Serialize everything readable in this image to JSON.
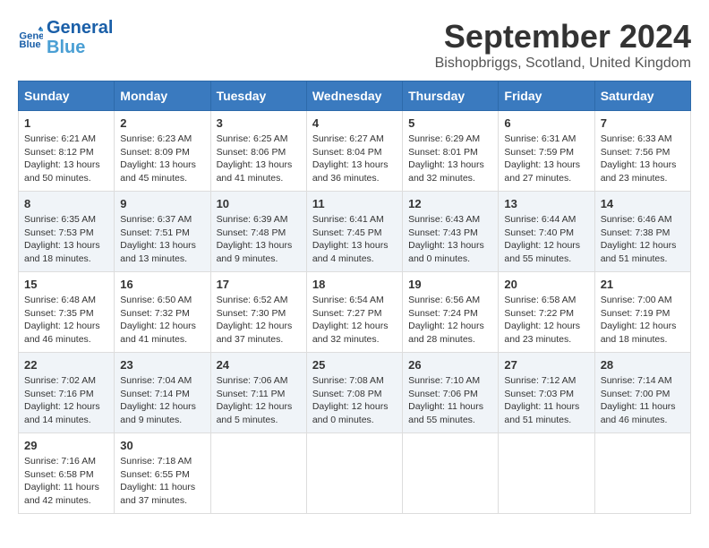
{
  "header": {
    "logo_line1": "General",
    "logo_line2": "Blue",
    "month": "September 2024",
    "location": "Bishopbriggs, Scotland, United Kingdom"
  },
  "weekdays": [
    "Sunday",
    "Monday",
    "Tuesday",
    "Wednesday",
    "Thursday",
    "Friday",
    "Saturday"
  ],
  "weeks": [
    [
      {
        "day": "1",
        "sunrise": "6:21 AM",
        "sunset": "8:12 PM",
        "daylight": "13 hours and 50 minutes."
      },
      {
        "day": "2",
        "sunrise": "6:23 AM",
        "sunset": "8:09 PM",
        "daylight": "13 hours and 45 minutes."
      },
      {
        "day": "3",
        "sunrise": "6:25 AM",
        "sunset": "8:06 PM",
        "daylight": "13 hours and 41 minutes."
      },
      {
        "day": "4",
        "sunrise": "6:27 AM",
        "sunset": "8:04 PM",
        "daylight": "13 hours and 36 minutes."
      },
      {
        "day": "5",
        "sunrise": "6:29 AM",
        "sunset": "8:01 PM",
        "daylight": "13 hours and 32 minutes."
      },
      {
        "day": "6",
        "sunrise": "6:31 AM",
        "sunset": "7:59 PM",
        "daylight": "13 hours and 27 minutes."
      },
      {
        "day": "7",
        "sunrise": "6:33 AM",
        "sunset": "7:56 PM",
        "daylight": "13 hours and 23 minutes."
      }
    ],
    [
      {
        "day": "8",
        "sunrise": "6:35 AM",
        "sunset": "7:53 PM",
        "daylight": "13 hours and 18 minutes."
      },
      {
        "day": "9",
        "sunrise": "6:37 AM",
        "sunset": "7:51 PM",
        "daylight": "13 hours and 13 minutes."
      },
      {
        "day": "10",
        "sunrise": "6:39 AM",
        "sunset": "7:48 PM",
        "daylight": "13 hours and 9 minutes."
      },
      {
        "day": "11",
        "sunrise": "6:41 AM",
        "sunset": "7:45 PM",
        "daylight": "13 hours and 4 minutes."
      },
      {
        "day": "12",
        "sunrise": "6:43 AM",
        "sunset": "7:43 PM",
        "daylight": "13 hours and 0 minutes."
      },
      {
        "day": "13",
        "sunrise": "6:44 AM",
        "sunset": "7:40 PM",
        "daylight": "12 hours and 55 minutes."
      },
      {
        "day": "14",
        "sunrise": "6:46 AM",
        "sunset": "7:38 PM",
        "daylight": "12 hours and 51 minutes."
      }
    ],
    [
      {
        "day": "15",
        "sunrise": "6:48 AM",
        "sunset": "7:35 PM",
        "daylight": "12 hours and 46 minutes."
      },
      {
        "day": "16",
        "sunrise": "6:50 AM",
        "sunset": "7:32 PM",
        "daylight": "12 hours and 41 minutes."
      },
      {
        "day": "17",
        "sunrise": "6:52 AM",
        "sunset": "7:30 PM",
        "daylight": "12 hours and 37 minutes."
      },
      {
        "day": "18",
        "sunrise": "6:54 AM",
        "sunset": "7:27 PM",
        "daylight": "12 hours and 32 minutes."
      },
      {
        "day": "19",
        "sunrise": "6:56 AM",
        "sunset": "7:24 PM",
        "daylight": "12 hours and 28 minutes."
      },
      {
        "day": "20",
        "sunrise": "6:58 AM",
        "sunset": "7:22 PM",
        "daylight": "12 hours and 23 minutes."
      },
      {
        "day": "21",
        "sunrise": "7:00 AM",
        "sunset": "7:19 PM",
        "daylight": "12 hours and 18 minutes."
      }
    ],
    [
      {
        "day": "22",
        "sunrise": "7:02 AM",
        "sunset": "7:16 PM",
        "daylight": "12 hours and 14 minutes."
      },
      {
        "day": "23",
        "sunrise": "7:04 AM",
        "sunset": "7:14 PM",
        "daylight": "12 hours and 9 minutes."
      },
      {
        "day": "24",
        "sunrise": "7:06 AM",
        "sunset": "7:11 PM",
        "daylight": "12 hours and 5 minutes."
      },
      {
        "day": "25",
        "sunrise": "7:08 AM",
        "sunset": "7:08 PM",
        "daylight": "12 hours and 0 minutes."
      },
      {
        "day": "26",
        "sunrise": "7:10 AM",
        "sunset": "7:06 PM",
        "daylight": "11 hours and 55 minutes."
      },
      {
        "day": "27",
        "sunrise": "7:12 AM",
        "sunset": "7:03 PM",
        "daylight": "11 hours and 51 minutes."
      },
      {
        "day": "28",
        "sunrise": "7:14 AM",
        "sunset": "7:00 PM",
        "daylight": "11 hours and 46 minutes."
      }
    ],
    [
      {
        "day": "29",
        "sunrise": "7:16 AM",
        "sunset": "6:58 PM",
        "daylight": "11 hours and 42 minutes."
      },
      {
        "day": "30",
        "sunrise": "7:18 AM",
        "sunset": "6:55 PM",
        "daylight": "11 hours and 37 minutes."
      },
      null,
      null,
      null,
      null,
      null
    ]
  ],
  "labels": {
    "sunrise": "Sunrise:",
    "sunset": "Sunset:",
    "daylight": "Daylight:"
  }
}
